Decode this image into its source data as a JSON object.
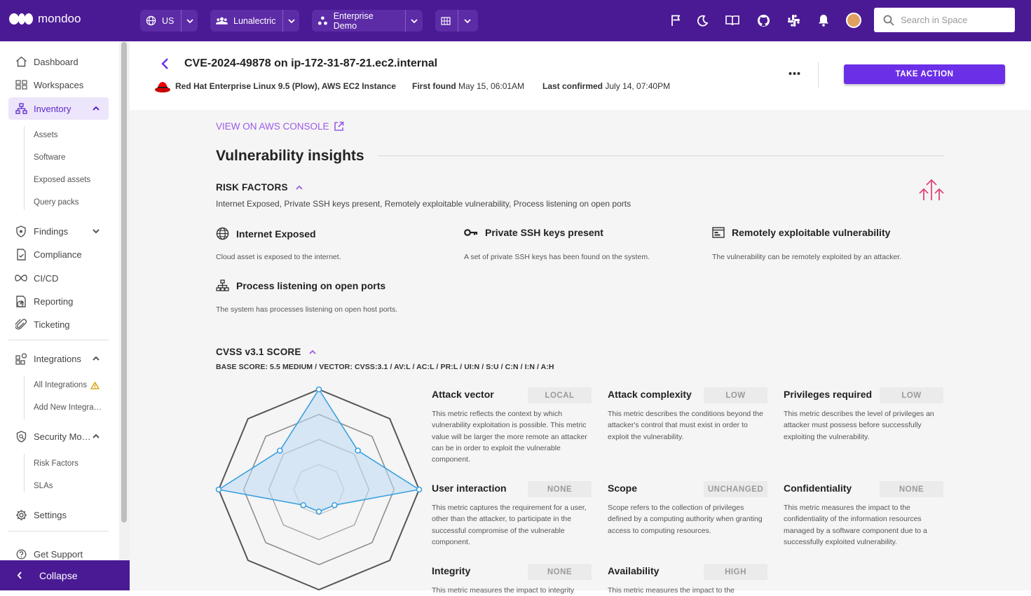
{
  "topbar": {
    "logo_text": "mondoo",
    "region": "US",
    "org": "Lunalectric",
    "space": "Enterprise Demo",
    "search_placeholder": "Search in Space"
  },
  "sidebar": {
    "dashboard": "Dashboard",
    "workspaces": "Workspaces",
    "inventory": "Inventory",
    "inventory_items": [
      "Assets",
      "Software",
      "Exposed assets",
      "Query packs"
    ],
    "findings": "Findings",
    "compliance": "Compliance",
    "cicd": "CI/CD",
    "reporting": "Reporting",
    "ticketing": "Ticketing",
    "integrations": "Integrations",
    "integration_items": [
      "All Integrations",
      "Add New Integra…"
    ],
    "security_model": "Security Mo…",
    "security_items": [
      "Risk Factors",
      "SLAs"
    ],
    "settings": "Settings",
    "support": "Get Support",
    "collapse": "Collapse"
  },
  "header": {
    "title": "CVE-2024-49878 on ip-172-31-87-21.ec2.internal",
    "platform": "Red Hat Enterprise Linux 9.5 (Plow), AWS EC2 Instance",
    "first_found_label": "First found",
    "first_found_value": "May 15, 06:01AM",
    "last_confirmed_label": "Last confirmed",
    "last_confirmed_value": "July 14, 07:40PM",
    "take_action": "TAKE ACTION"
  },
  "content": {
    "aws_link": "VIEW ON AWS CONSOLE",
    "insights_title": "Vulnerability insights",
    "risk_factors": {
      "title": "RISK FACTORS",
      "summary": "Internet Exposed, Private SSH keys present, Remotely exploitable vulnerability, Process listening on open ports",
      "items": [
        {
          "title": "Internet Exposed",
          "desc": "Cloud asset is exposed to the internet.",
          "icon": "globe-icon"
        },
        {
          "title": "Private SSH keys present",
          "desc": "A set of private SSH keys has been found on the system.",
          "icon": "key-icon"
        },
        {
          "title": "Remotely exploitable vulnerability",
          "desc": "The vulnerability can be remotely exploited by an attacker.",
          "icon": "terminal-window-icon"
        },
        {
          "title": "Process listening on open ports",
          "desc": "The system has processes listening on open host ports.",
          "icon": "network-tree-icon"
        }
      ]
    },
    "cvss": {
      "title": "CVSS v3.1 SCORE",
      "base": "BASE SCORE: 5.5 MEDIUM / VECTOR: CVSS:3.1 / AV:L / AC:L / PR:L / UI:N / S:U / C:N / I:N / A:H",
      "metrics": [
        {
          "name": "Attack vector",
          "value": "LOCAL",
          "desc": "This metric reflects the context by which vulnerability exploitation is possible. This metric value will be larger the more remote an attacker can be in order to exploit the vulnerable component."
        },
        {
          "name": "Attack complexity",
          "value": "LOW",
          "desc": "This metric describes the conditions beyond the attacker's control that must exist in order to exploit the vulnerability."
        },
        {
          "name": "Privileges required",
          "value": "LOW",
          "desc": "This metric describes the level of privileges an attacker must possess before successfully exploiting the vulnerability."
        },
        {
          "name": "User interaction",
          "value": "NONE",
          "desc": "This metric captures the requirement for a user, other than the attacker, to participate in the successful compromise of the vulnerable component."
        },
        {
          "name": "Scope",
          "value": "UNCHANGED",
          "desc": "Scope refers to the collection of privileges defined by a computing authority when granting access to computing resources."
        },
        {
          "name": "Confidentiality",
          "value": "NONE",
          "desc": "This metric measures the impact to the confidentiality of the information resources managed by a software component due to a successfully exploited vulnerability."
        },
        {
          "name": "Integrity",
          "value": "NONE",
          "desc": "This metric measures the impact to integrity"
        },
        {
          "name": "Availability",
          "value": "HIGH",
          "desc": "This metric measures the impact to the"
        }
      ]
    }
  },
  "chart_data": {
    "type": "radar",
    "axes": [
      "Attack vector",
      "Attack complexity",
      "Privileges required",
      "User interaction",
      "Scope",
      "Confidentiality",
      "Integrity",
      "Availability"
    ],
    "values": [
      1.0,
      0.55,
      1.0,
      0.22,
      0.22,
      0.22,
      1.0,
      0.55
    ],
    "rlim": [
      0,
      1
    ],
    "rings": 4,
    "grid": true,
    "stroke": "#3aa0e0",
    "fill": "#bcd9f2"
  },
  "colors": {
    "topbar": "#4a1a94",
    "accent": "#6c2fe8",
    "link": "#9b59e8",
    "risk_icon": "#e0457b"
  }
}
